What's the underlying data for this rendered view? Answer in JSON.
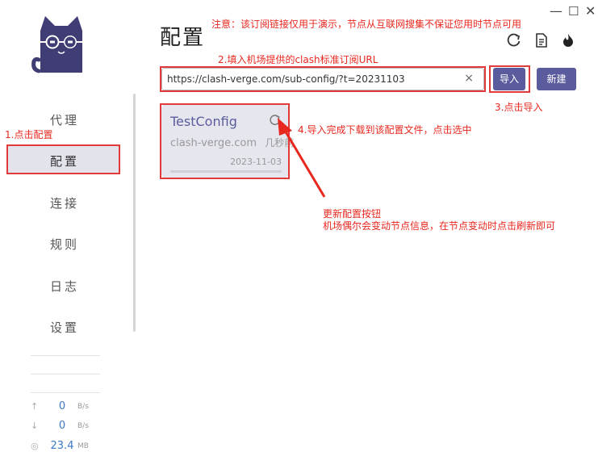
{
  "window_controls": {
    "minimize": "—",
    "maximize": "☐",
    "close": "✕"
  },
  "sidebar": {
    "items": [
      {
        "label": "代理"
      },
      {
        "label": "配置"
      },
      {
        "label": "连接"
      },
      {
        "label": "规则"
      },
      {
        "label": "日志"
      },
      {
        "label": "设置"
      }
    ],
    "active_index": 1,
    "traffic": {
      "upload": {
        "value": "0",
        "unit": "B/s"
      },
      "download": {
        "value": "0",
        "unit": "B/s"
      },
      "memory": {
        "value": "23.4",
        "unit": "MB"
      }
    }
  },
  "main": {
    "title": "配置",
    "header_icons": [
      "refresh-icon",
      "file-icon",
      "fire-icon"
    ],
    "url_input": {
      "value": "https://clash-verge.com/sub-config/?t=20231103",
      "clear": "×"
    },
    "import_button": "导入",
    "new_button": "新建",
    "profile_card": {
      "name": "TestConfig",
      "host": "clash-verge.com",
      "updated": "几秒前",
      "date": "2023-11-03"
    }
  },
  "annotations": {
    "notice": "注意：该订阅链接仅用于演示，节点从互联网搜集不保证您用时节点可用",
    "step1": "1.点击配置",
    "step2": "2.填入机场提供的clash标准订阅URL",
    "step3": "3.点击导入",
    "step4": "4.导入完成下载到该配置文件，点击选中",
    "refresh_title": "更新配置按钮",
    "refresh_desc": "机场偶尔会变动节点信息，在节点变动时点击刷新即可"
  },
  "colors": {
    "accent": "#5b5c9d",
    "annotation": "#e8281f",
    "active_bg": "#e3e3ec"
  }
}
